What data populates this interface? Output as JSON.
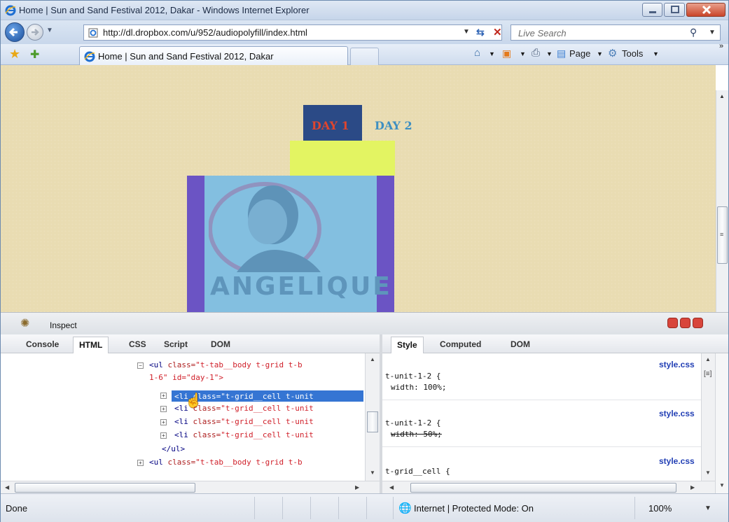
{
  "window": {
    "title": "Home | Sun and Sand Festival 2012, Dakar - Windows Internet Explorer"
  },
  "address_bar": {
    "url": "http://dl.dropbox.com/u/952/audiopolyfill/index.html",
    "search_placeholder": "Live Search"
  },
  "tabs": {
    "active_label": "Home | Sun and Sand Festival 2012, Dakar"
  },
  "command_bar": {
    "page_label": "Page",
    "tools_label": "Tools",
    "overflow": "»"
  },
  "page": {
    "day1": "DAY 1",
    "day2": "DAY 2",
    "artist": "ANGELIQUE",
    "colors": {
      "background": "#e9dcb2",
      "day1_bg": "#2b4a86",
      "day1_text": "#e0452d",
      "day2_text": "#3d8fc2",
      "yellow": "#e3f462",
      "purple": "#6b54c4",
      "panel_blue": "#83bfe0"
    }
  },
  "devtools": {
    "inspect_label": "Inspect",
    "left_tabs": [
      "Console",
      "HTML",
      "CSS",
      "Script",
      "DOM"
    ],
    "right_tabs": [
      "Style",
      "Computed",
      "DOM"
    ],
    "html_lines": [
      {
        "open": "<ul ",
        "attr": "class=",
        "val": "\"t-tab__body t-grid t-b"
      },
      {
        "cont": "1-6\" id=\"day-1\">"
      },
      {
        "open": "<li ",
        "attr": "class=",
        "val": "\"t-grid__cell t-unit"
      },
      {
        "open": "<li ",
        "attr": "class=",
        "val": "\"t-grid__cell t-unit"
      },
      {
        "open": "<li ",
        "attr": "class=",
        "val": "\"t-grid__cell t-unit"
      },
      {
        "open": "<li ",
        "attr": "class=",
        "val": "\"t-grid__cell t-unit"
      },
      {
        "close": "</ul>"
      },
      {
        "open": "<ul ",
        "attr": "class=",
        "val": "\"t-tab__body t-grid t-b"
      }
    ],
    "styles": [
      {
        "selector": "t-unit-1-2 {",
        "property": "width: 100%;",
        "source": "style.css",
        "overridden": false
      },
      {
        "selector": "t-unit-1-2 {",
        "property": "width: 50%;",
        "source": "style.css",
        "overridden": true
      },
      {
        "selector": "t-grid__cell {",
        "property": "",
        "source": "style.css",
        "overridden": false
      }
    ]
  },
  "statusbar": {
    "status": "Done",
    "zone": "Internet | Protected Mode: On",
    "zoom": "100%"
  }
}
